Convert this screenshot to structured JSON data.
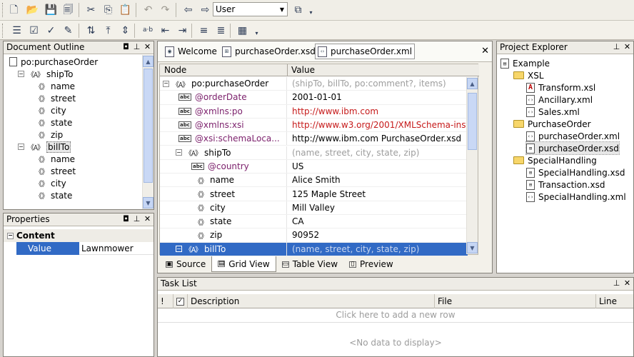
{
  "toolbar": {
    "buttons1": [
      {
        "name": "new-file-icon",
        "glyph": "🗋"
      },
      {
        "name": "open-folder-icon",
        "glyph": "📂"
      },
      {
        "name": "save-icon",
        "glyph": "💾"
      },
      {
        "name": "save-all-icon",
        "glyph": "🗐"
      },
      {
        "name": "cut-icon",
        "glyph": "✂"
      },
      {
        "name": "copy-icon",
        "glyph": "⎘"
      },
      {
        "name": "paste-icon",
        "glyph": "📋"
      },
      {
        "name": "undo-icon",
        "glyph": "↶"
      },
      {
        "name": "redo-icon",
        "glyph": "↷"
      },
      {
        "name": "back-icon",
        "glyph": "⇦"
      },
      {
        "name": "forward-icon",
        "glyph": "⇨"
      }
    ],
    "user_combo_value": "User",
    "buttons2": [
      {
        "name": "align-icon",
        "glyph": "☰"
      },
      {
        "name": "validate-icon",
        "glyph": "☑"
      },
      {
        "name": "check-icon",
        "glyph": "✓"
      },
      {
        "name": "edit-icon",
        "glyph": "✎"
      },
      {
        "name": "sort-asc-icon",
        "glyph": "⇅"
      },
      {
        "name": "sort-top-icon",
        "glyph": "⤒"
      },
      {
        "name": "expand-icon",
        "glyph": "⇕"
      },
      {
        "name": "spell-icon",
        "glyph": "a·b"
      },
      {
        "name": "outdent-icon",
        "glyph": "⇤"
      },
      {
        "name": "indent-icon",
        "glyph": "⇥"
      },
      {
        "name": "list-icon",
        "glyph": "≡"
      },
      {
        "name": "list-numbered-icon",
        "glyph": "≣"
      },
      {
        "name": "schema-icon",
        "glyph": "▦"
      }
    ]
  },
  "outline": {
    "title": "Document Outline",
    "items": [
      {
        "label": "po:purchaseOrder",
        "indent": 0,
        "type": "root"
      },
      {
        "label": "shipTo",
        "indent": 1,
        "type": "complex"
      },
      {
        "label": "name",
        "indent": 2,
        "type": "elem"
      },
      {
        "label": "street",
        "indent": 2,
        "type": "elem"
      },
      {
        "label": "city",
        "indent": 2,
        "type": "elem"
      },
      {
        "label": "state",
        "indent": 2,
        "type": "elem"
      },
      {
        "label": "zip",
        "indent": 2,
        "type": "elem"
      },
      {
        "label": "billTo",
        "indent": 1,
        "type": "complex"
      },
      {
        "label": "name",
        "indent": 2,
        "type": "elem"
      },
      {
        "label": "street",
        "indent": 2,
        "type": "elem"
      },
      {
        "label": "city",
        "indent": 2,
        "type": "elem"
      },
      {
        "label": "state",
        "indent": 2,
        "type": "elem"
      }
    ]
  },
  "properties": {
    "title": "Properties",
    "section": "Content",
    "row_label": "Value",
    "row_value": "Lawnmower"
  },
  "editor": {
    "tabs": [
      "Welcome",
      "purchaseOrder.xsd",
      "purchaseOrder.xml"
    ],
    "col_node": "Node",
    "col_value": "Value",
    "rows": [
      {
        "node": "po:purchaseOrder",
        "value": "(shipTo, billTo, po:comment?, items)",
        "kind": "root"
      },
      {
        "node": "@orderDate",
        "value": "2001-01-01",
        "kind": "attr"
      },
      {
        "node": "@xmlns:po",
        "value": "http://www.ibm.com",
        "kind": "attr-url"
      },
      {
        "node": "@xmlns:xsi",
        "value": "http://www.w3.org/2001/XMLSchema-instance",
        "kind": "attr-url"
      },
      {
        "node": "@xsi:schemaLoca...",
        "value": "http://www.ibm.com PurchaseOrder.xsd",
        "kind": "attr"
      },
      {
        "node": "shipTo",
        "value": "(name, street, city, state, zip)",
        "kind": "complex"
      },
      {
        "node": "@country",
        "value": "US",
        "kind": "attr2"
      },
      {
        "node": "name",
        "value": "Alice Smith",
        "kind": "elem"
      },
      {
        "node": "street",
        "value": "125 Maple Street",
        "kind": "elem"
      },
      {
        "node": "city",
        "value": "Mill Valley",
        "kind": "elem"
      },
      {
        "node": "state",
        "value": "CA",
        "kind": "elem"
      },
      {
        "node": "zip",
        "value": "90952",
        "kind": "elem"
      },
      {
        "node": "billTo",
        "value": "(name, street, city, state, zip)",
        "kind": "complex-sel"
      }
    ],
    "view_tabs": [
      "Source",
      "Grid View",
      "Table View",
      "Preview"
    ],
    "active_view": "Grid View"
  },
  "project": {
    "title": "Project Explorer",
    "items": [
      {
        "label": "Example",
        "indent": 0,
        "type": "proj"
      },
      {
        "label": "XSL",
        "indent": 1,
        "type": "folder"
      },
      {
        "label": "Transform.xsl",
        "indent": 2,
        "type": "xsl"
      },
      {
        "label": "Ancillary.xml",
        "indent": 2,
        "type": "xml"
      },
      {
        "label": "Sales.xml",
        "indent": 2,
        "type": "xml"
      },
      {
        "label": "PurchaseOrder",
        "indent": 1,
        "type": "folder"
      },
      {
        "label": "purchaseOrder.xml",
        "indent": 2,
        "type": "xml"
      },
      {
        "label": "purchaseOrder.xsd",
        "indent": 2,
        "type": "xsd",
        "selected": true
      },
      {
        "label": "SpecialHandling",
        "indent": 1,
        "type": "folder"
      },
      {
        "label": "SpecialHandling.xsd",
        "indent": 2,
        "type": "xsd"
      },
      {
        "label": "Transaction.xsd",
        "indent": 2,
        "type": "xsd"
      },
      {
        "label": "SpecialHandling.xml",
        "indent": 2,
        "type": "xml"
      }
    ]
  },
  "tasklist": {
    "title": "Task List",
    "col_bang": "!",
    "col_desc": "Description",
    "col_file": "File",
    "col_line": "Line",
    "add_prompt": "Click here to add a new row",
    "empty": "<No data to display>"
  },
  "colors": {
    "selection": "#316ac5",
    "attr": "#7b1f6b",
    "url": "#c61a1a",
    "model": "#9d9d9d"
  }
}
